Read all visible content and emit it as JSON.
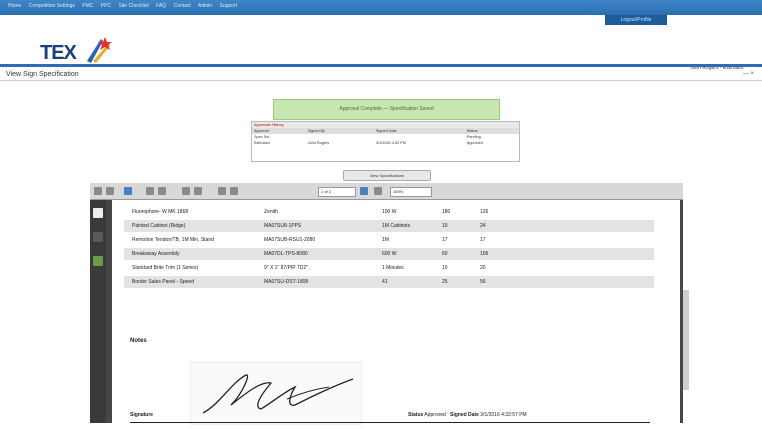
{
  "topnav": {
    "links": [
      "Home",
      "Competition Settings",
      "PMC",
      "PPC",
      "Site Checklist",
      "FAQ",
      "Contact",
      "Admin",
      "Support"
    ]
  },
  "header": {
    "logo_text": "TEX",
    "user_box": "Logout/Profile",
    "welcome": "John Rogers - Estimator"
  },
  "page": {
    "title": "View Sign Specification",
    "collapse": "— ×"
  },
  "banner": {
    "text": "Approval Complete — Specification Saved"
  },
  "approvals": {
    "caption": "Approvals History",
    "headers": [
      "Approver",
      "Signed By",
      "Signed Date",
      "Status"
    ],
    "rows": [
      [
        "Spec Sw",
        "",
        "",
        "Pending"
      ],
      [
        "Estimator",
        "John Rogers",
        "3/1/2016 4:32 PM",
        "Approved"
      ]
    ]
  },
  "view_button": {
    "label": "View Specifications"
  },
  "pdf_toolbar": {
    "page_value": "1 of 2",
    "zoom_value": "100%"
  },
  "pdf_rows": [
    {
      "c1": "Fluorophore- W MK 1868",
      "c2": "Zenith",
      "c3": "100 W",
      "c4": "180",
      "c5": "126",
      "shade": false
    },
    {
      "c1": "Painted Cabinet (Ridge)",
      "c2": "MA07SU8-1PPS",
      "c3": "1M Cabinets",
      "c4": "15",
      "c5": "24",
      "shade": true
    },
    {
      "c1": "Remotion Tendon/TB, 1M Min, Stand",
      "c2": "MA07SUB-RSU1-2080",
      "c3": "1M",
      "c4": "17",
      "c5": "17",
      "shade": false
    },
    {
      "c1": "Breakaway Assembly",
      "c2": "MA07DL-TPS-8080",
      "c3": "600 W",
      "c4": "60",
      "c5": "106",
      "shade": true
    },
    {
      "c1": "Standard Brite Trim (1 Series)",
      "c2": "9\" X 1\" 87/PIP 7D2\"",
      "c3": "1 Minutes",
      "c4": "10",
      "c5": "20",
      "shade": false
    },
    {
      "c1": "Border Sales Panel - Speed",
      "c2": "MA07SU-DST-1808",
      "c3": "41",
      "c4": "25",
      "c5": "56",
      "shade": true
    }
  ],
  "notes_label": "Notes",
  "signature": {
    "label": "Signature",
    "status_label": "Status",
    "status_value": "Approved",
    "date_label": "Signed Date",
    "date_value": "3/1/2016 4:32:57 PM"
  },
  "icons": {
    "sidebar": [
      "document-icon",
      "bookmark-icon",
      "attachment-icon"
    ]
  }
}
